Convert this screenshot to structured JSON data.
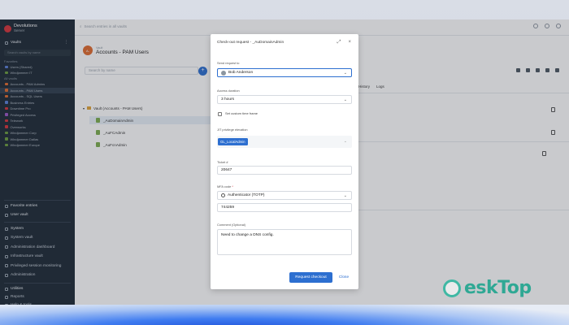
{
  "sidebar": {
    "brand": "Devolutions",
    "brand_sub": "Server",
    "vaults_label": "Vaults",
    "search_placeholder": "Search vaults by name",
    "favorites_section": "Favorites",
    "all_vaults_section": "All vaults",
    "vault_items": [
      {
        "label": "Users (Shared)",
        "color": "#5a7fd6"
      },
      {
        "label": "Windjammer IT",
        "color": "#6b9c3e"
      },
      {
        "label": "Accounts - PAM Admins",
        "color": "#e06b2e"
      },
      {
        "label": "Accounts - PAM Users",
        "color": "#e06b2e"
      },
      {
        "label": "Accounts - SQL Users",
        "color": "#e06b2e"
      },
      {
        "label": "Business Entries",
        "color": "#5a7fd6"
      },
      {
        "label": "Downtime Pro",
        "color": "#d6333a"
      },
      {
        "label": "Privileged Access",
        "color": "#9a56c4"
      },
      {
        "label": "Telework",
        "color": "#d6333a"
      },
      {
        "label": "Overworks",
        "color": "#d6333a"
      },
      {
        "label": "Windjammer Corp",
        "color": "#6b9c3e"
      },
      {
        "label": "Windjammer Dallas",
        "color": "#6b9c3e"
      },
      {
        "label": "Windjammer Europe",
        "color": "#6b9c3e"
      }
    ],
    "favorite_entries": "Favorite entries",
    "user_vault": "User vault",
    "system_label": "System",
    "system_items": [
      "System vault",
      "Administration dashboard",
      "Infrastructure vault",
      "Privileged session monitoring",
      "Administration"
    ],
    "utilities_label": "Utilities",
    "utilities_items": [
      "Reports",
      "Help & tools"
    ]
  },
  "topbar": {
    "search_placeholder": "Search entries in all vaults"
  },
  "vault": {
    "badge": "A-",
    "subtitle": "Vault",
    "title": "Accounts - PAM Users",
    "search_placeholder": "Search by name",
    "root": "Vault (Accounts - PAM Users)",
    "entries": [
      "_AuDomainAdmin",
      "_AuFCAdmin",
      "_AuFcnAdmin"
    ]
  },
  "detail": {
    "tabs": [
      "History",
      "Logs"
    ]
  },
  "modal": {
    "title": "Check-out request - _AuDomainAdmin",
    "send_request_label": "Send request to",
    "send_request_value": "Bob Anderson",
    "duration_label": "Access duration",
    "duration_value": "3 hours",
    "custom_time_label": "Set custom time frame",
    "jit_label": "JIT privilege elevation",
    "jit_chip": "GL_LocalAdmin",
    "ticket_label": "Ticket #",
    "ticket_value": "20647",
    "mfa_label": "MFA code",
    "mfa_method": "Authenticator (TOTP)",
    "mfa_value": "744259",
    "comment_label": "Comment (Optional)",
    "comment_value": "Need to change a DNS config.",
    "submit_label": "Request checkout",
    "close_label": "Close"
  },
  "watermark": {
    "text": "eskTop"
  }
}
